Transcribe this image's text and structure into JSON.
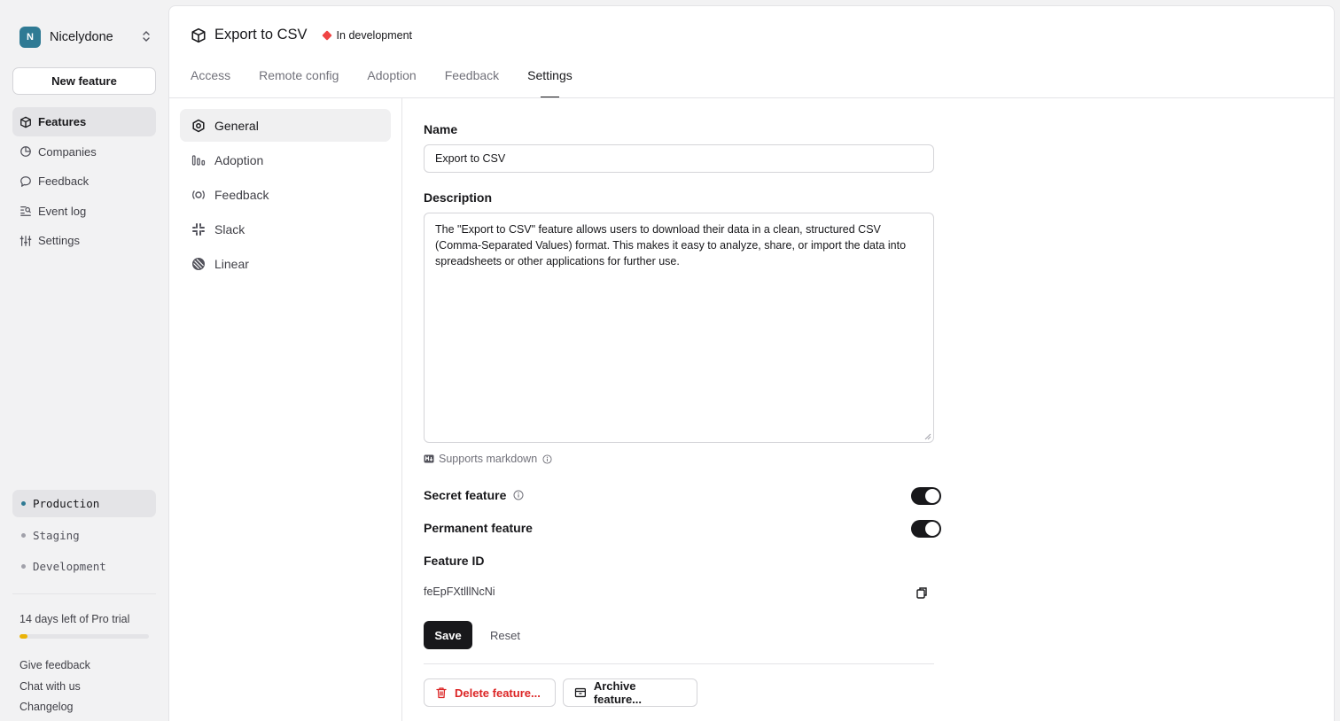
{
  "org": {
    "initial": "N",
    "name": "Nicelydone"
  },
  "sidebar": {
    "new_feature_label": "New feature",
    "items": [
      {
        "label": "Features",
        "icon": "cube-icon",
        "active": true
      },
      {
        "label": "Companies",
        "icon": "pie-chart-icon",
        "active": false
      },
      {
        "label": "Feedback",
        "icon": "chat-bubble-icon",
        "active": false
      },
      {
        "label": "Event log",
        "icon": "log-search-icon",
        "active": false
      },
      {
        "label": "Settings",
        "icon": "sliders-icon",
        "active": false
      }
    ],
    "environments": [
      {
        "label": "Production",
        "active": true
      },
      {
        "label": "Staging",
        "active": false
      },
      {
        "label": "Development",
        "active": false
      }
    ],
    "trial_text": "14 days left of Pro trial",
    "trial_progress": 0.06,
    "footer_links": [
      "Give feedback",
      "Chat with us",
      "Changelog"
    ]
  },
  "header": {
    "title": "Export to CSV",
    "status": "In development",
    "tabs": [
      "Access",
      "Remote config",
      "Adoption",
      "Feedback",
      "Settings"
    ],
    "active_tab": "Settings"
  },
  "subnav": {
    "items": [
      {
        "label": "General",
        "icon": "hexagon-icon",
        "active": true
      },
      {
        "label": "Adoption",
        "icon": "adoption-bars-icon",
        "active": false
      },
      {
        "label": "Feedback",
        "icon": "feedback-ring-icon",
        "active": false
      },
      {
        "label": "Slack",
        "icon": "slack-icon",
        "active": false
      },
      {
        "label": "Linear",
        "icon": "linear-icon",
        "active": false
      }
    ]
  },
  "form": {
    "name_label": "Name",
    "name_value": "Export to CSV",
    "description_label": "Description",
    "description_value": "The \"Export to CSV\" feature allows users to download their data in a clean, structured CSV (Comma-Separated Values) format. This makes it easy to analyze, share, or import the data into spreadsheets or other applications for further use.",
    "markdown_hint": "Supports markdown",
    "secret_label": "Secret feature",
    "secret_on": true,
    "permanent_label": "Permanent feature",
    "permanent_on": true,
    "feature_id_label": "Feature ID",
    "feature_id_value": "feEpFXtlllNcNi",
    "save_label": "Save",
    "reset_label": "Reset",
    "delete_label": "Delete feature...",
    "archive_label": "Archive feature..."
  },
  "colors": {
    "accent": "#2f7a94",
    "danger": "#dc2626",
    "status": "#ef4444",
    "trial": "#eab308"
  }
}
